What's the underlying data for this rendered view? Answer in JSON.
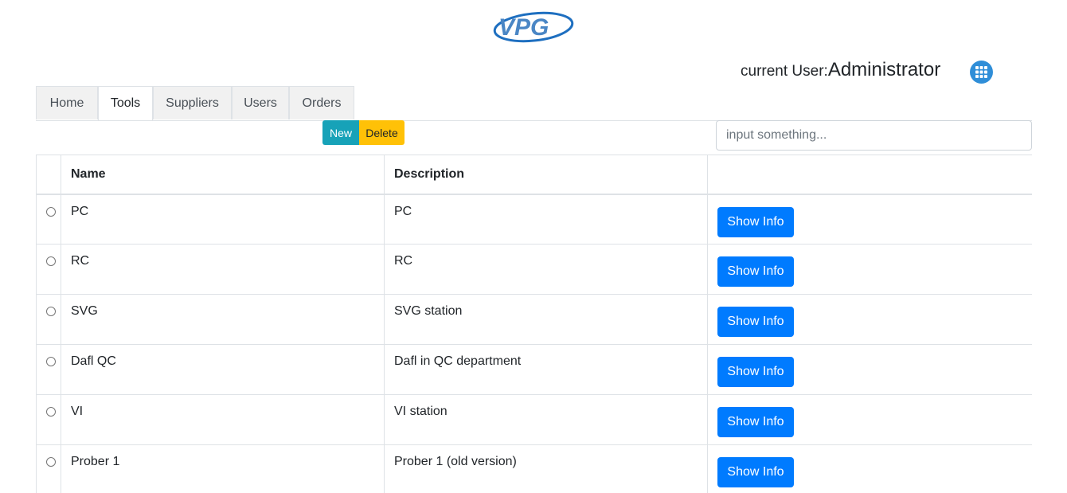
{
  "header": {
    "logo_text": "VPG",
    "user_prefix": "current User:",
    "user_name": "Administrator",
    "apps_icon": "grid-apps-icon",
    "accent_color": "#2f8ed8"
  },
  "tabs": [
    {
      "label": "Home",
      "active": false
    },
    {
      "label": "Tools",
      "active": true
    },
    {
      "label": "Suppliers",
      "active": false
    },
    {
      "label": "Users",
      "active": false
    },
    {
      "label": "Orders",
      "active": false
    }
  ],
  "toolbar": {
    "new_label": "New",
    "delete_label": "Delete",
    "new_color": "#17a2b8",
    "delete_color": "#ffc107"
  },
  "search": {
    "placeholder": "input something...",
    "value": ""
  },
  "table": {
    "columns": [
      "",
      "Name",
      "Description",
      ""
    ],
    "action_label": "Show Info",
    "action_color": "#007bff",
    "rows": [
      {
        "name": "PC",
        "description": "PC"
      },
      {
        "name": "RC",
        "description": "RC"
      },
      {
        "name": "SVG",
        "description": "SVG station"
      },
      {
        "name": "Dafl QC",
        "description": "Dafl in QC department"
      },
      {
        "name": "VI",
        "description": "VI station"
      },
      {
        "name": "Prober 1",
        "description": "Prober 1 (old version)"
      }
    ]
  }
}
